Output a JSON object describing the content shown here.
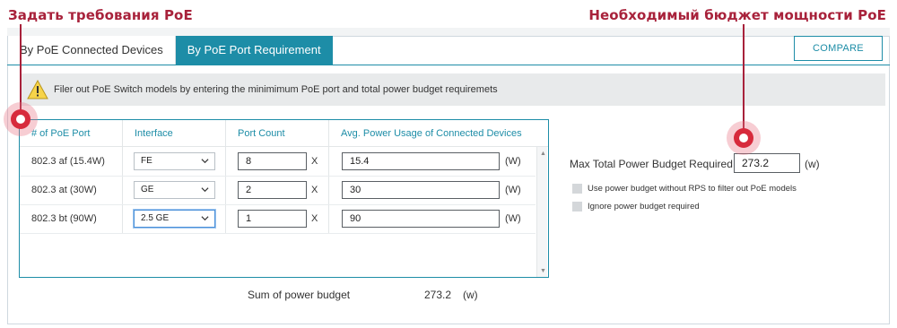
{
  "callouts": {
    "left": "Задать требования PoE",
    "right": "Необходимый бюджет мощности PoE"
  },
  "tabs": [
    {
      "label": "By PoE Connected Devices",
      "active": false
    },
    {
      "label": "By PoE Port Requirement",
      "active": true
    }
  ],
  "compare_label": "COMPARE",
  "notice": {
    "icon": "warning-icon",
    "text": "Filer out PoE Switch models by entering the minimimum PoE port and total power budget requiremets"
  },
  "table": {
    "headers": [
      "# of PoE Port",
      "Interface",
      "Port Count",
      "Avg. Power Usage of Connected Devices"
    ],
    "rows": [
      {
        "port": "802.3 af (15.4W)",
        "interface": "FE",
        "count": "8",
        "power": "15.4"
      },
      {
        "port": "802.3 at (30W)",
        "interface": "GE",
        "count": "2",
        "power": "30"
      },
      {
        "port": "802.3 bt (90W)",
        "interface": "2.5 GE",
        "count": "1",
        "power": "90"
      }
    ],
    "multiplier": "X",
    "unit": "(W)"
  },
  "sum": {
    "label": "Sum of power budget",
    "value": "273.2",
    "unit": "(w)"
  },
  "budget": {
    "label": "Max Total Power Budget Required",
    "value": "273.2",
    "unit": "(w)"
  },
  "options": [
    {
      "label": "Use power budget without RPS to filter out PoE models",
      "checked": false
    },
    {
      "label": "Ignore power budget required",
      "checked": false
    }
  ],
  "colors": {
    "accent": "#1d8da7",
    "callout": "#a8223b",
    "marker": "#d72a3c"
  }
}
